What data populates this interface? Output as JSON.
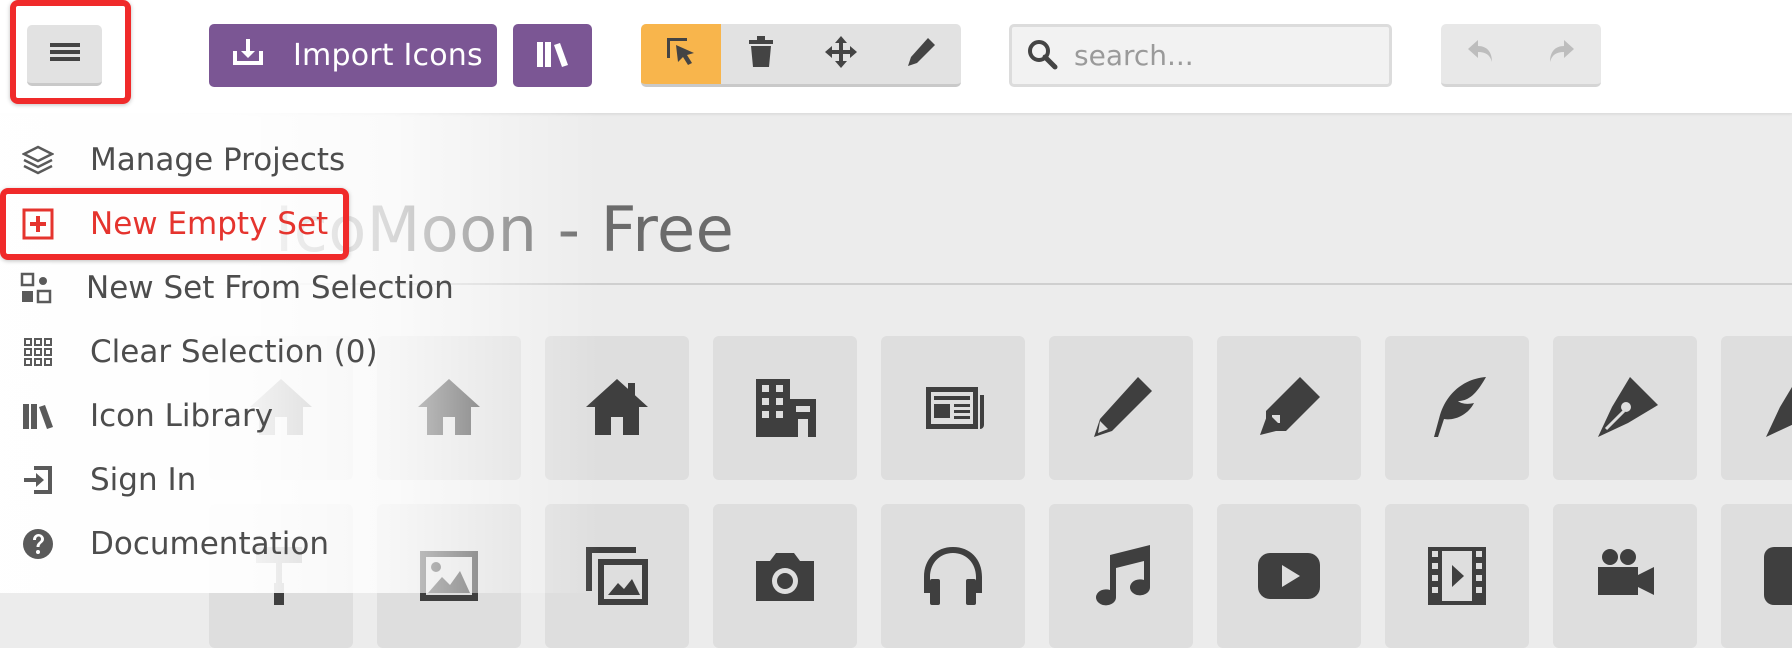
{
  "toolbar": {
    "menu_icon": "hamburger-icon",
    "import_label": "Import Icons",
    "import_icon": "import-tray-icon",
    "library_icon": "books-icon",
    "tools": [
      {
        "name": "select",
        "icon": "cursor-select-icon",
        "active": true
      },
      {
        "name": "delete",
        "icon": "trash-icon",
        "active": false
      },
      {
        "name": "move",
        "icon": "move-arrows-icon",
        "active": false
      },
      {
        "name": "edit",
        "icon": "pencil-icon",
        "active": false
      }
    ],
    "search_placeholder": "search...",
    "undo_icon": "undo-icon",
    "redo_icon": "redo-icon"
  },
  "main_menu": {
    "items": [
      {
        "label": "Manage Projects",
        "icon": "layers-icon"
      },
      {
        "label": "New Empty Set",
        "icon": "plus-square-icon",
        "highlighted": true
      },
      {
        "label": "New Set From Selection",
        "icon": "selection-shapes-icon"
      },
      {
        "label": "Clear Selection (0)",
        "icon": "dots-grid-icon"
      },
      {
        "label": "Icon Library",
        "icon": "books-icon"
      },
      {
        "label": "Sign In",
        "icon": "sign-in-icon"
      },
      {
        "label": "Documentation",
        "icon": "help-circle-icon"
      }
    ]
  },
  "icon_set": {
    "title": "IcoMoon - Free",
    "rows": [
      [
        "home",
        "home2",
        "home3",
        "office",
        "newspaper",
        "pencil",
        "pencil2",
        "quill",
        "pen",
        "blog"
      ],
      [
        "paint-format",
        "image",
        "images",
        "camera",
        "headphones",
        "music",
        "play",
        "film",
        "video-camera",
        "dice"
      ]
    ]
  },
  "colors": {
    "accent_purple": "#7b5694",
    "active_tool": "#f8b54c",
    "highlight_red": "#f02a2a",
    "danger_text": "#e5342e"
  }
}
